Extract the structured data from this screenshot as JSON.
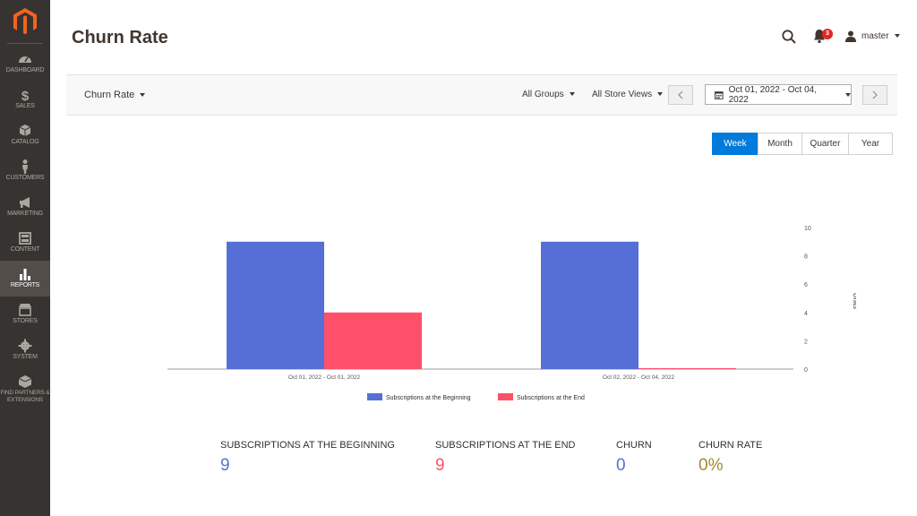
{
  "sidebar": {
    "logo": "magento-logo",
    "items": [
      {
        "label": "DASHBOARD",
        "icon": "dashboard-icon"
      },
      {
        "label": "SALES",
        "icon": "dollar-icon"
      },
      {
        "label": "CATALOG",
        "icon": "cube-icon"
      },
      {
        "label": "CUSTOMERS",
        "icon": "person-icon"
      },
      {
        "label": "MARKETING",
        "icon": "megaphone-icon"
      },
      {
        "label": "CONTENT",
        "icon": "layout-icon"
      },
      {
        "label": "REPORTS",
        "icon": "bar-chart-icon",
        "active": true
      },
      {
        "label": "STORES",
        "icon": "store-icon"
      },
      {
        "label": "SYSTEM",
        "icon": "gear-icon"
      },
      {
        "label": "FIND PARTNERS & EXTENSIONS",
        "icon": "box-icon"
      }
    ]
  },
  "header": {
    "title": "Churn Rate",
    "notifications_count": "3",
    "user": "master"
  },
  "toolbar": {
    "report_select": "Churn Rate",
    "groups": "All Groups",
    "store_views": "All Store Views",
    "date_range": "Oct 01, 2022 - Oct 04, 2022"
  },
  "period": {
    "options": [
      "Week",
      "Month",
      "Quarter",
      "Year"
    ],
    "selected": "Week"
  },
  "chart_data": {
    "type": "bar",
    "categories": [
      "Oct 01, 2022 - Oct 01, 2022",
      "Oct 02, 2022 - Oct 04, 2022"
    ],
    "series": [
      {
        "name": "Subscriptions at the Beginning",
        "values": [
          9,
          9
        ],
        "color": "#566fd6"
      },
      {
        "name": "Subscriptions at the End",
        "values": [
          4,
          0
        ],
        "color": "#ff5069"
      }
    ],
    "ylabel": "Units",
    "ylim": [
      0,
      10
    ],
    "yticks": [
      "0",
      "2",
      "4",
      "6",
      "8",
      "10"
    ],
    "legend": "bottom"
  },
  "kpis": [
    {
      "label": "Subscriptions at the Beginning",
      "value": "9",
      "color": "#566fd6"
    },
    {
      "label": "Subscriptions at the End",
      "value": "9",
      "color": "#ff5069"
    },
    {
      "label": "Churn",
      "value": "0",
      "color": "#566fd6"
    },
    {
      "label": "Churn Rate",
      "value": "0%",
      "color": "#a08a2e"
    }
  ]
}
